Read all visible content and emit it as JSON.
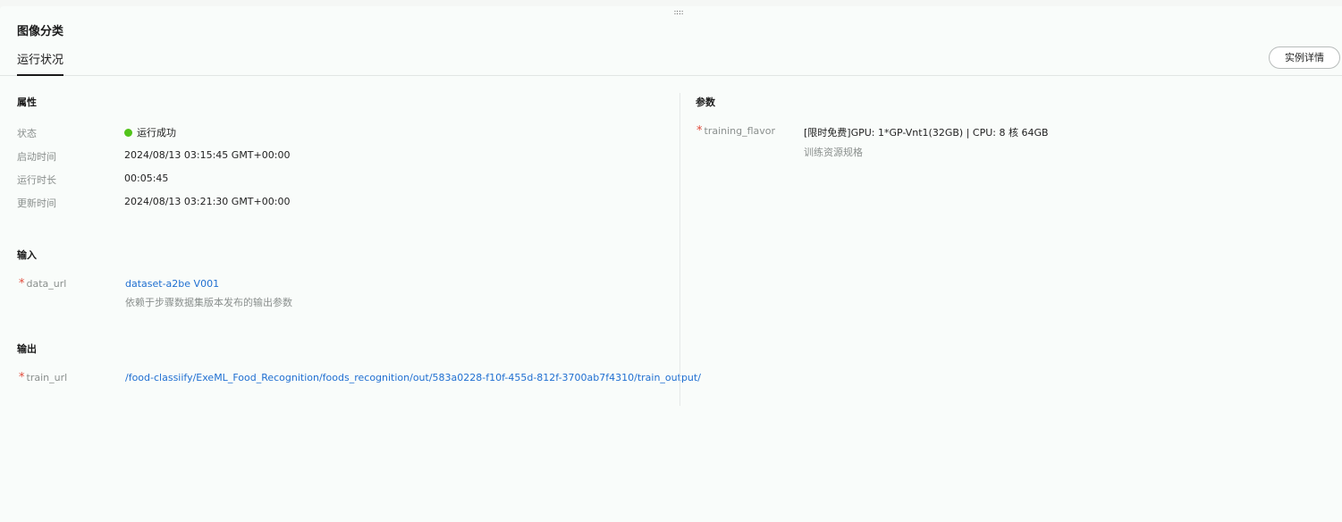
{
  "app": {
    "drag_handle": "::::"
  },
  "header": {
    "title": "图像分类",
    "tabs": [
      {
        "label": "运行状况"
      }
    ],
    "detail_button": "实例详情"
  },
  "attributes": {
    "heading": "属性",
    "status": {
      "label": "状态",
      "value": "运行成功",
      "color": "#52c41a"
    },
    "start_time": {
      "label": "启动时间",
      "value": "2024/08/13 03:15:45 GMT+00:00"
    },
    "duration": {
      "label": "运行时长",
      "value": "00:05:45"
    },
    "update_time": {
      "label": "更新时间",
      "value": "2024/08/13 03:21:30 GMT+00:00"
    }
  },
  "inputs": {
    "heading": "输入",
    "data_url": {
      "required_mark": "*",
      "label": "data_url",
      "value": "dataset-a2be V001",
      "hint": "依赖于步骤数据集版本发布的输出参数"
    }
  },
  "outputs": {
    "heading": "输出",
    "train_url": {
      "required_mark": "*",
      "label": "train_url",
      "value": "/food-classiify/ExeML_Food_Recognition/foods_recognition/out/583a0228-f10f-455d-812f-3700ab7f4310/train_output/"
    }
  },
  "params": {
    "heading": "参数",
    "training_flavor": {
      "required_mark": "*",
      "label": "training_flavor",
      "value": "[限时免费]GPU: 1*GP-Vnt1(32GB) | CPU: 8 核 64GB",
      "hint": "训练资源规格"
    }
  }
}
